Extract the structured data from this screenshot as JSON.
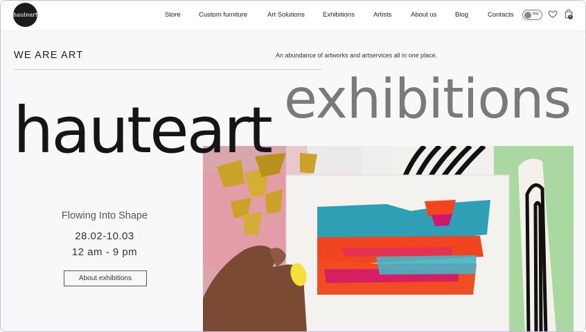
{
  "brand": {
    "logo_text": "hauteart"
  },
  "nav": {
    "items": [
      "Store",
      "Custom furniture",
      "Art Solutions",
      "Exhibitions",
      "Artists",
      "About us",
      "Blog",
      "Contacts"
    ]
  },
  "header_controls": {
    "theme_toggle_label": "day",
    "cart_count": "0"
  },
  "hero": {
    "we_are": "WE ARE ART",
    "tagline": "An abundance of artworks and artservices all in one place.",
    "headline_gray": "exhibitions",
    "headline_black": "hauteart"
  },
  "exhibition": {
    "title": "Flowing Into Shape",
    "dates": "28.02-10.03",
    "hours": "12 am - 9 pm",
    "button_label": "About exhibitions"
  },
  "colors": {
    "frame_border": "#c9b8ee",
    "headline_gray": "#7a7a7a",
    "headline_black": "#151515",
    "paint_blue": "#2e9fb5",
    "paint_red": "#f0451e",
    "paint_magenta": "#d1166e",
    "gold_leaf": "#c9a227",
    "mint_background": "#a9d8a0"
  }
}
